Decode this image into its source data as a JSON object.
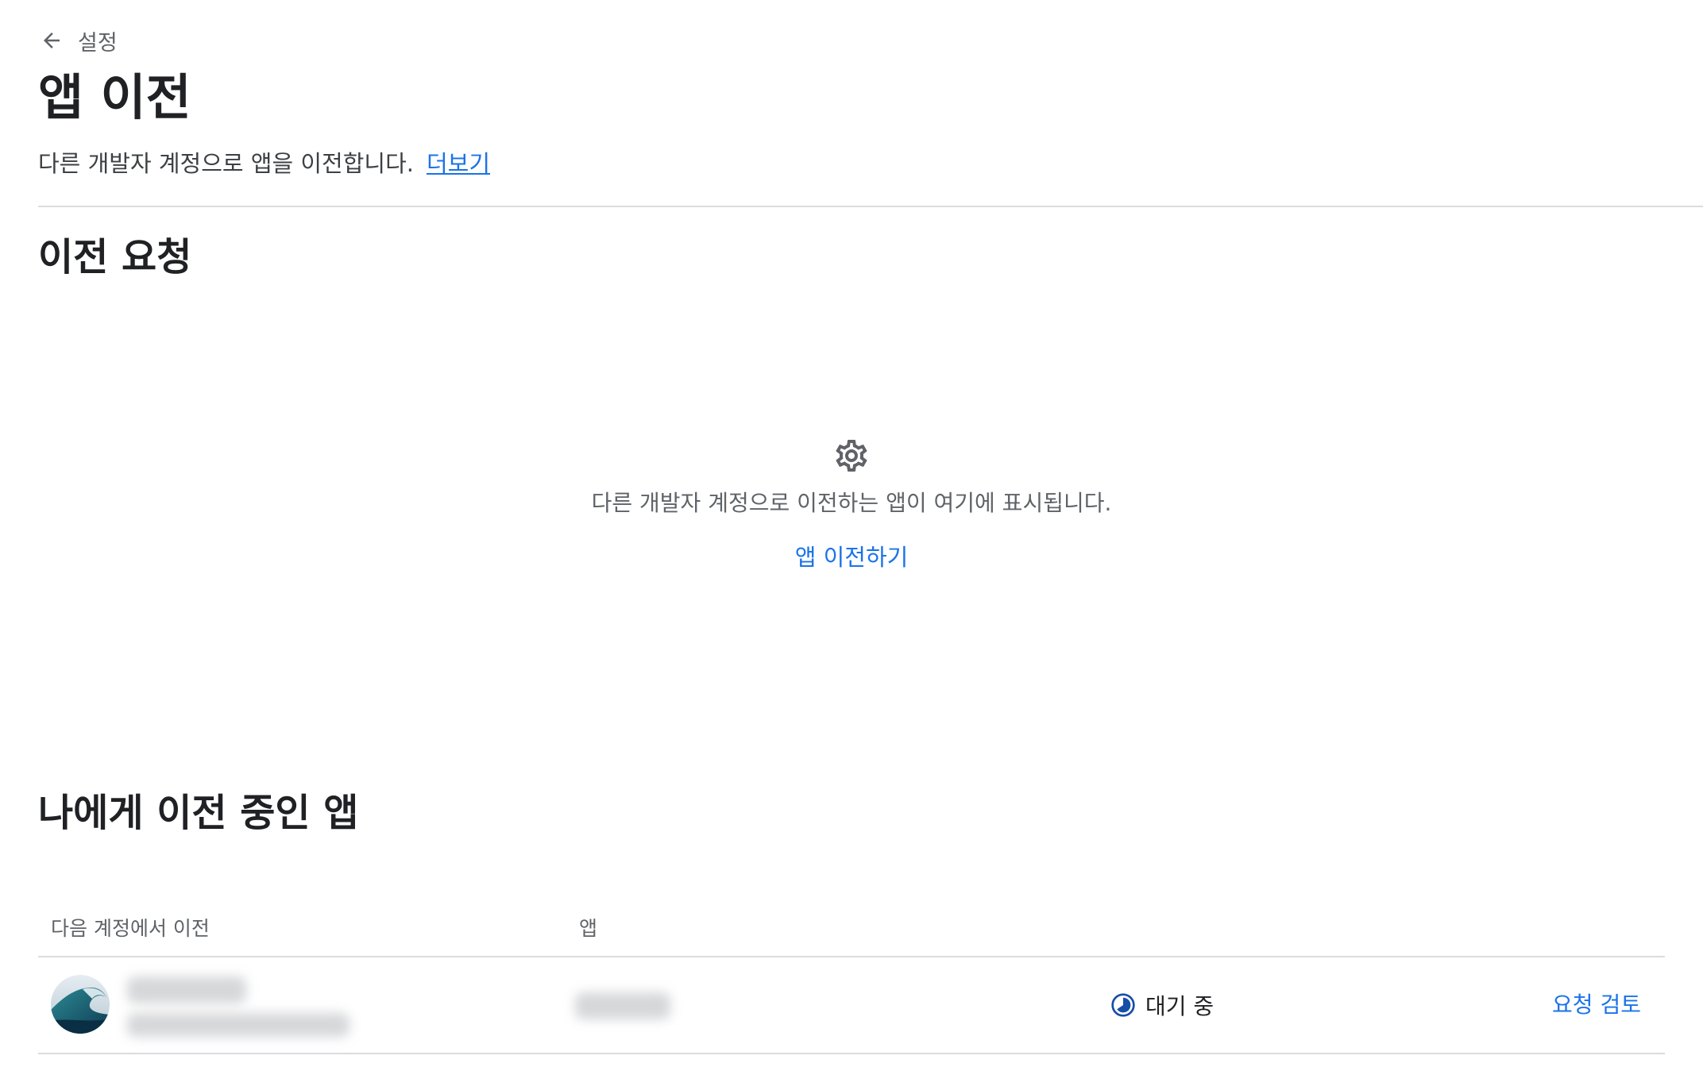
{
  "header": {
    "back_label": "설정",
    "title": "앱 이전",
    "description": "다른 개발자 계정으로 앱을 이전합니다.",
    "learn_more": "더보기"
  },
  "transfer_requests": {
    "title": "이전 요청",
    "empty_icon": "gear-icon",
    "empty_text": "다른 개발자 계정으로 이전하는 앱이 여기에 표시됩니다.",
    "action": "앱 이전하기"
  },
  "incoming": {
    "title": "나에게 이전 중인 앱",
    "columns": [
      "다음 계정에서 이전",
      "앱"
    ],
    "rows": [
      {
        "status": "대기 중",
        "status_icon": "pending-clock-icon",
        "action": "요청 검토"
      }
    ]
  },
  "colors": {
    "accent": "#1a73e8",
    "status_icon": "#174ea6",
    "divider": "#dadce0"
  }
}
